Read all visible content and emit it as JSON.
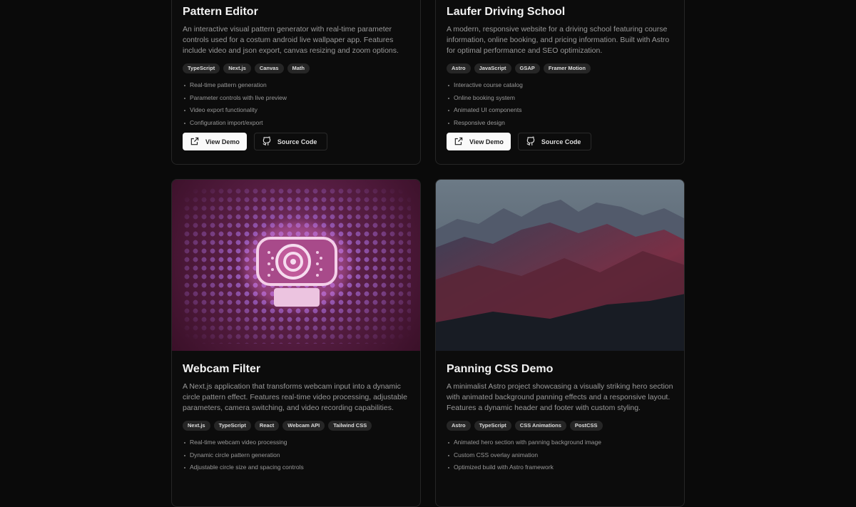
{
  "projects": [
    {
      "title": "Pattern Editor",
      "description": "An interactive visual pattern generator with real-time parameter controls used for a costum android live wallpaper app. Features include video and json export, canvas resizing and zoom options.",
      "tags": [
        "TypeScript",
        "Next.js",
        "Canvas",
        "Math"
      ],
      "features": [
        "Real-time pattern generation",
        "Parameter controls with live preview",
        "Video export functionality",
        "Configuration import/export"
      ],
      "demo_label": "View Demo",
      "source_label": "Source Code"
    },
    {
      "title": "Laufer Driving School",
      "description": "A modern, responsive website for a driving school featuring course information, online booking, and pricing information. Built with Astro for optimal performance and SEO optimization.",
      "tags": [
        "Astro",
        "JavaScript",
        "GSAP",
        "Framer Motion"
      ],
      "features": [
        "Interactive course catalog",
        "Online booking system",
        "Animated UI components",
        "Responsive design"
      ],
      "demo_label": "View Demo",
      "source_label": "Source Code"
    },
    {
      "title": "Webcam Filter",
      "description": "A Next.js application that transforms webcam input into a dynamic circle pattern effect. Features real-time video processing, adjustable parameters, camera switching, and video recording capabilities.",
      "tags": [
        "Next.js",
        "TypeScript",
        "React",
        "Webcam API",
        "Tailwind CSS"
      ],
      "features": [
        "Real-time webcam video processing",
        "Dynamic circle pattern generation",
        "Adjustable circle size and spacing controls"
      ]
    },
    {
      "title": "Panning CSS Demo",
      "description": "A minimalist Astro project showcasing a visually striking hero section with animated background panning effects and a responsive layout. Features a dynamic header and footer with custom styling.",
      "tags": [
        "Astro",
        "TypeScript",
        "CSS Animations",
        "PostCSS"
      ],
      "features": [
        "Animated hero section with panning background image",
        "Custom CSS overlay animation",
        "Optimized build with Astro framework"
      ]
    }
  ]
}
